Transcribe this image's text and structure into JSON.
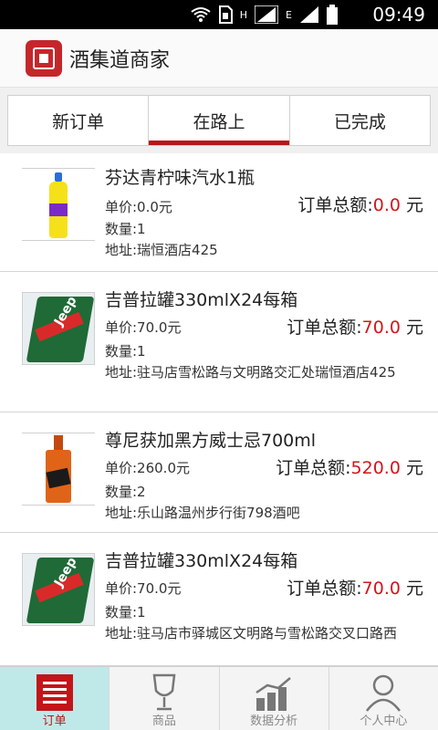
{
  "status_bar": {
    "signal_a_label": "H",
    "signal_b_label": "E",
    "time": "09:49",
    "icons": [
      "wifi-icon",
      "sim-icon",
      "signal-icon",
      "signal-icon",
      "battery-icon"
    ]
  },
  "app_bar": {
    "title": "酒集道商家",
    "logo_icon": "wine-logo-icon",
    "brand_color": "#c4272b"
  },
  "tabs": [
    {
      "label": "新订单",
      "active": false
    },
    {
      "label": "在路上",
      "active": true
    },
    {
      "label": "已完成",
      "active": false
    }
  ],
  "orders": [
    {
      "name": "芬达青柠味汽水1瓶",
      "unit_price": "单价:0.0元",
      "quantity": "数量:1",
      "address": "地址:瑞恒酒店425",
      "total_label": "订单总额:",
      "total_amount": "0.0",
      "total_unit": " 元",
      "image_icon": "soda-bottle-icon"
    },
    {
      "name": "吉普拉罐330mlX24每箱",
      "unit_price": "单价:70.0元",
      "quantity": "数量:1",
      "address": "地址:驻马店雪松路与文明路交汇处瑞恒酒店425",
      "total_label": "订单总额:",
      "total_amount": "70.0",
      "total_unit": " 元",
      "image_icon": "beer-can-icon",
      "can_brand": "Jeep"
    },
    {
      "name": "尊尼获加黑方威士忌700ml",
      "unit_price": "单价:260.0元",
      "quantity": "数量:2",
      "address": "地址:乐山路温州步行街798酒吧",
      "total_label": "订单总额:",
      "total_amount": "520.0",
      "total_unit": " 元",
      "image_icon": "whisky-bottle-icon"
    },
    {
      "name": "吉普拉罐330mlX24每箱",
      "unit_price": "单价:70.0元",
      "quantity": "数量:1",
      "address": "地址:驻马店市驿城区文明路与雪松路交叉口路西",
      "total_label": "订单总额:",
      "total_amount": "70.0",
      "total_unit": " 元",
      "image_icon": "beer-can-icon",
      "can_brand": "Jeep"
    }
  ],
  "bottom_nav": [
    {
      "label": "订单",
      "icon": "order-list-icon",
      "active": true
    },
    {
      "label": "商品",
      "icon": "wine-glass-icon",
      "active": false
    },
    {
      "label": "数据分析",
      "icon": "bar-chart-icon",
      "active": false
    },
    {
      "label": "个人中心",
      "icon": "person-icon",
      "active": false
    }
  ],
  "colors": {
    "accent": "#b9141a",
    "price_red": "#d4141a",
    "active_nav_bg": "#bfe9e9"
  }
}
